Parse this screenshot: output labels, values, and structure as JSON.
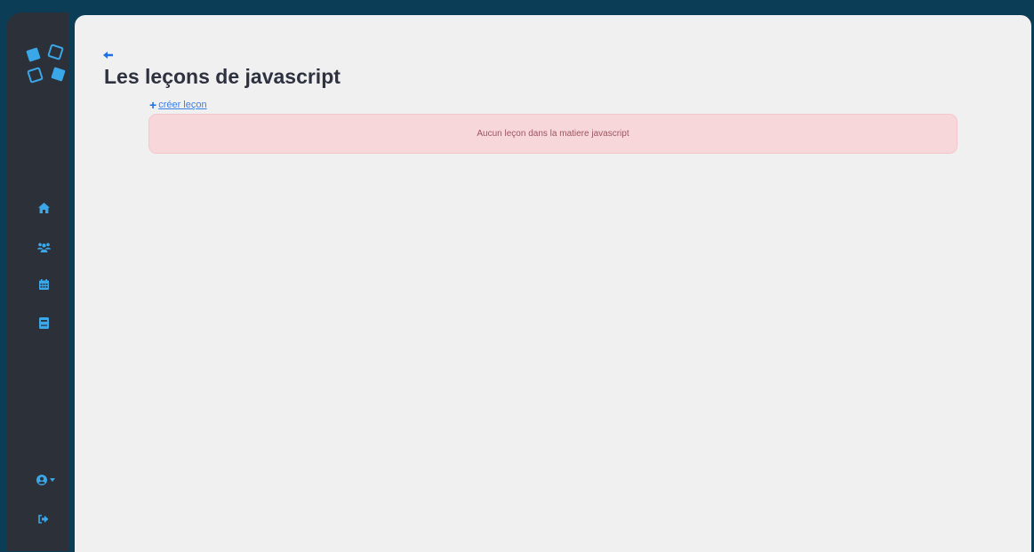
{
  "page": {
    "title": "Les leçons de javascript",
    "create_link": {
      "plus": "+",
      "label": "créer leçon"
    },
    "empty_alert": "Aucun leçon dans la matiere javascript"
  },
  "sidebar": {
    "icons": [
      {
        "name": "home-icon"
      },
      {
        "name": "users-icon"
      },
      {
        "name": "calendar-icon"
      },
      {
        "name": "book-icon"
      }
    ],
    "bottom_icons": [
      {
        "name": "user-account-icon"
      },
      {
        "name": "logout-icon"
      }
    ]
  },
  "colors": {
    "accent": "#1f6fe0",
    "sidebar_icon": "#3aa7e8",
    "sidebar_bg": "#2c3039",
    "frame_bg": "#0b3d57",
    "content_bg": "#f0f0f0",
    "alert_bg": "#f8d7da",
    "alert_text": "#9b5560",
    "title_text": "#2e3240"
  }
}
